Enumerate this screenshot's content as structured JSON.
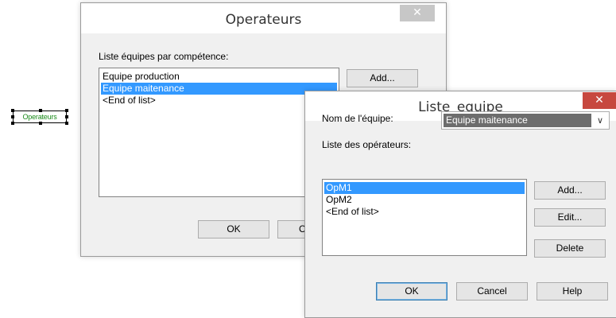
{
  "canvas": {
    "object_label": "Operateurs"
  },
  "operateurs_dialog": {
    "title": "Operateurs",
    "close_icon": "close-icon",
    "list_label": "Liste équipes par compétence:",
    "list_items": [
      {
        "text": "Equipe production",
        "selected": false
      },
      {
        "text": "Equipe maitenance",
        "selected": true
      },
      {
        "text": "<End of list>",
        "selected": false
      }
    ],
    "add_button": "Add...",
    "ok_button": "OK",
    "cancel_button_partial": "C"
  },
  "liste_equipe_dialog": {
    "title": "Liste_equipe",
    "close_icon": "close-icon",
    "close_color": "#c7483f",
    "team_name_label": "Nom de l'équipe:",
    "team_name_value": "Equipe maitenance",
    "operators_label": "Liste des opérateurs:",
    "operators": [
      {
        "text": "OpM1",
        "selected": true
      },
      {
        "text": "OpM2",
        "selected": false
      },
      {
        "text": "<End of list>",
        "selected": false
      }
    ],
    "add_button": "Add...",
    "edit_button": "Edit...",
    "delete_button": "Delete",
    "ok_button": "OK",
    "cancel_button": "Cancel",
    "help_button": "Help"
  },
  "colors": {
    "selection": "#3399ff",
    "dialog_bg": "#f0f0f0",
    "inactive_close": "#c7c7c7",
    "active_close": "#c7483f"
  }
}
